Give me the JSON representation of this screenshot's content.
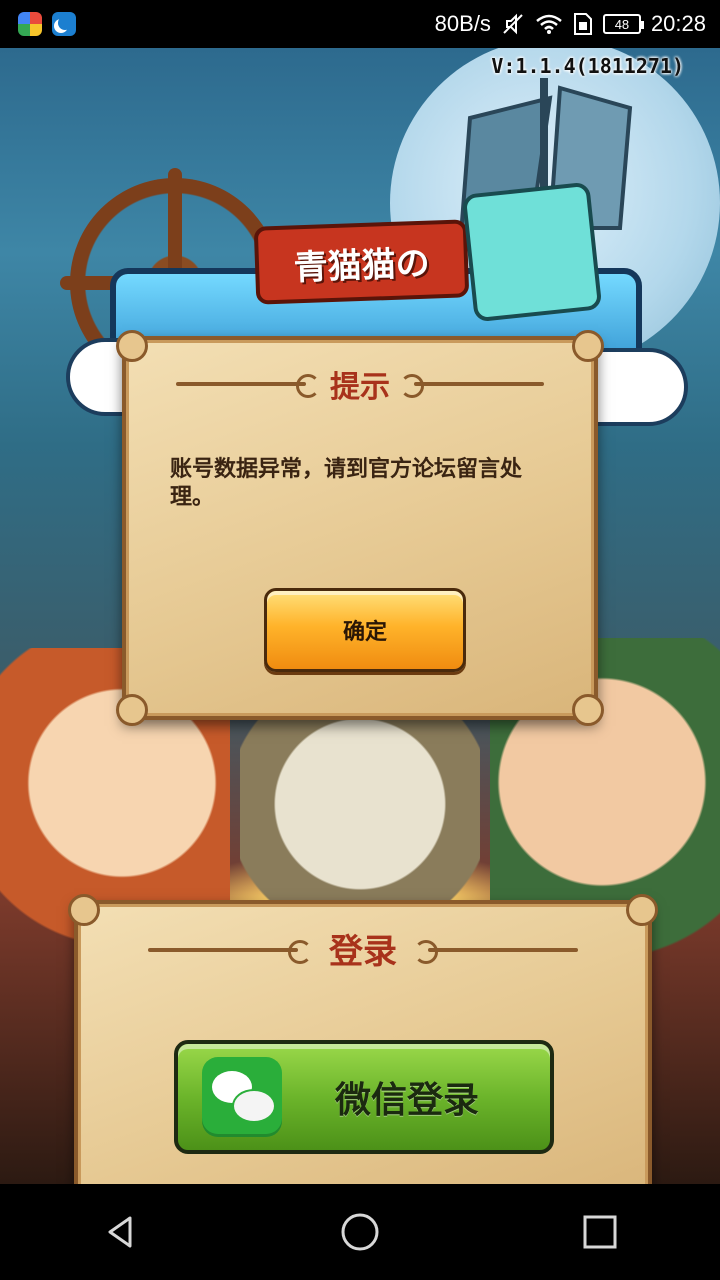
{
  "status_bar": {
    "network_speed": "80B/s",
    "battery": "48",
    "time": "20:28"
  },
  "game": {
    "version": "V:1.1.4(1811271)",
    "title_banner": "青猫猫の"
  },
  "dialog": {
    "title": "提示",
    "message": "账号数据异常，请到官方论坛留言处理。",
    "confirm_label": "确定"
  },
  "login": {
    "title": "登录",
    "wechat_label": "微信登录"
  },
  "nav": {
    "icons": [
      "back-icon",
      "home-icon",
      "recents-icon"
    ]
  }
}
